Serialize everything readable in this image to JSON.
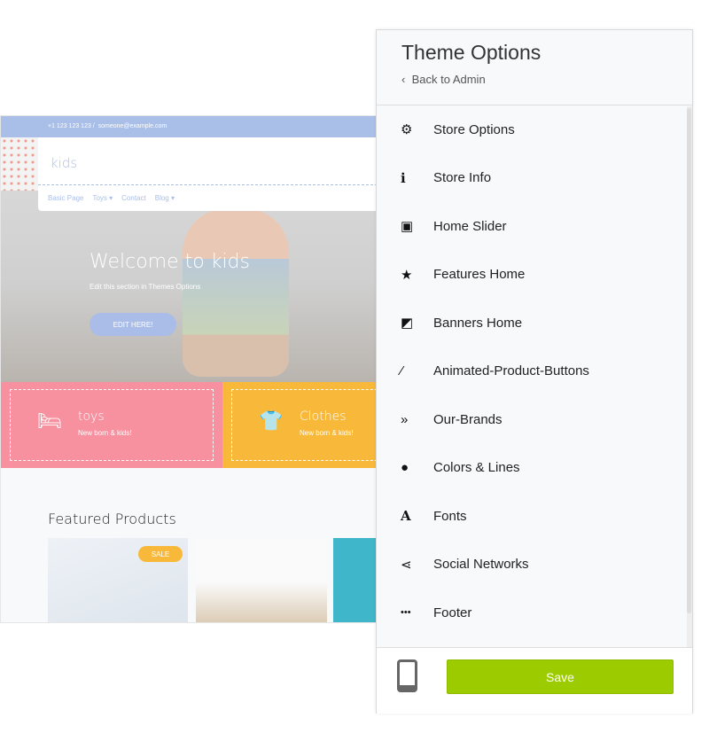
{
  "site": {
    "phone": "+1 123 123 123 /",
    "email": "someone@example.com",
    "logo": "kids",
    "nav": [
      "Basic Page",
      "Toys ▾",
      "Contact",
      "Blog ▾"
    ],
    "hero_title": "Welcome to kids",
    "hero_sub": "Edit this section in Themes Options",
    "edit_button": "EDIT HERE!",
    "categories": [
      {
        "title": "toys",
        "sub": "New born & kids!",
        "icon": "bed-icon",
        "color": "#f7909f"
      },
      {
        "title": "Clothes",
        "sub": "New born & kids!",
        "icon": "tshirt-icon",
        "color": "#f8b93a"
      }
    ],
    "featured_title": "Featured Products",
    "sale_badge": "SALE"
  },
  "panel": {
    "title": "Theme Options",
    "back": "Back to Admin",
    "items": [
      {
        "label": "Store Options",
        "icon": "⚙"
      },
      {
        "label": "Store Info",
        "icon": "ℹ"
      },
      {
        "label": "Home Slider",
        "icon": "▣"
      },
      {
        "label": "Features Home",
        "icon": "★"
      },
      {
        "label": "Banners Home",
        "icon": "◩"
      },
      {
        "label": "Animated-Product-Buttons",
        "icon": "⁄"
      },
      {
        "label": "Our-Brands",
        "icon": "»"
      },
      {
        "label": "Colors & Lines",
        "icon": "●"
      },
      {
        "label": "Fonts",
        "icon": "A"
      },
      {
        "label": "Social Networks",
        "icon": "⋖"
      },
      {
        "label": "Footer",
        "icon": "•••"
      }
    ],
    "save": "Save",
    "accent": "#9ccc00"
  }
}
